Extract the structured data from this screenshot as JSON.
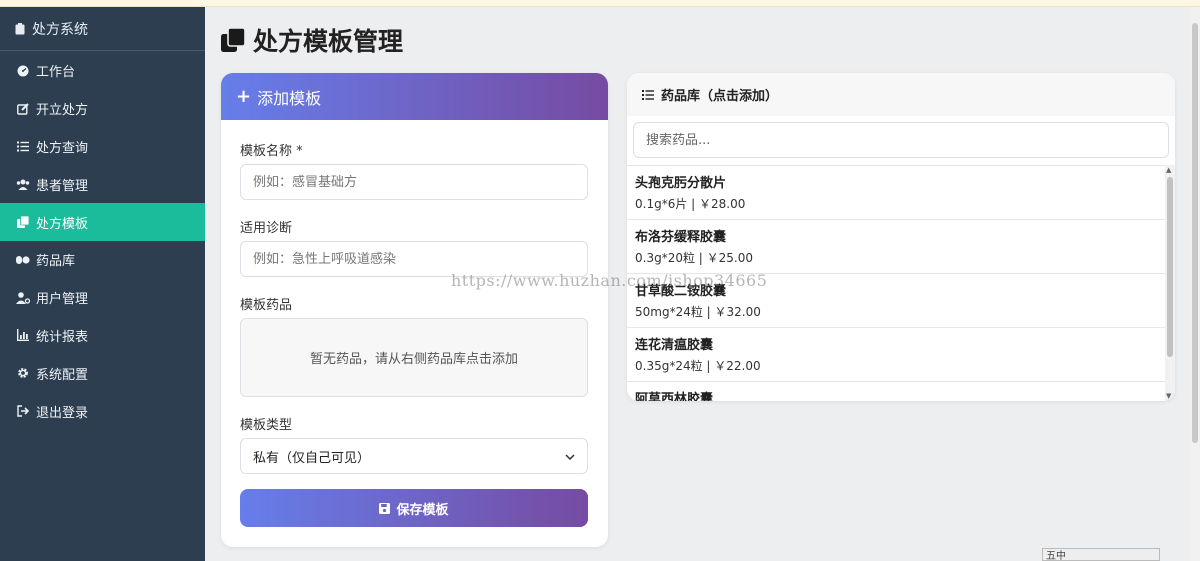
{
  "sidebar": {
    "brand": "处方系统",
    "items": [
      {
        "label": "工作台",
        "icon": "dashboard-icon"
      },
      {
        "label": "开立处方",
        "icon": "edit-icon"
      },
      {
        "label": "处方查询",
        "icon": "list-icon"
      },
      {
        "label": "患者管理",
        "icon": "users-icon"
      },
      {
        "label": "处方模板",
        "icon": "copy-icon",
        "active": true
      },
      {
        "label": "药品库",
        "icon": "pills-icon"
      },
      {
        "label": "用户管理",
        "icon": "user-cog-icon"
      },
      {
        "label": "统计报表",
        "icon": "chart-icon"
      },
      {
        "label": "系统配置",
        "icon": "gear-icon"
      },
      {
        "label": "退出登录",
        "icon": "logout-icon"
      }
    ]
  },
  "page": {
    "title": "处方模板管理"
  },
  "add_template": {
    "header": "添加模板",
    "name_label": "模板名称 *",
    "name_placeholder": "例如：感冒基础方",
    "diagnosis_label": "适用诊断",
    "diagnosis_placeholder": "例如：急性上呼吸道感染",
    "drugs_label": "模板药品",
    "drugs_empty": "暂无药品，请从右侧药品库点击添加",
    "type_label": "模板类型",
    "type_value": "私有（仅自己可见）",
    "save_label": "保存模板"
  },
  "drug_library": {
    "header": "药品库（点击添加）",
    "search_placeholder": "搜索药品...",
    "items": [
      {
        "name": "头孢克肟分散片",
        "info": "0.1g*6片 | ￥28.00"
      },
      {
        "name": "布洛芬缓释胶囊",
        "info": "0.3g*20粒 | ￥25.00"
      },
      {
        "name": "甘草酸二铵胶囊",
        "info": "50mg*24粒 | ￥32.00"
      },
      {
        "name": "连花清瘟胶囊",
        "info": "0.35g*24粒 | ￥22.00"
      },
      {
        "name": "阿莫西林胶囊",
        "info": ""
      }
    ]
  },
  "watermark": "https://www.huzhan.com/ishop34665",
  "ime_bar": "五中",
  "colors": {
    "sidebar_bg": "#2c3e50",
    "active_item": "#1abc9c",
    "gradient_start": "#667eea",
    "gradient_end": "#764ba2"
  }
}
